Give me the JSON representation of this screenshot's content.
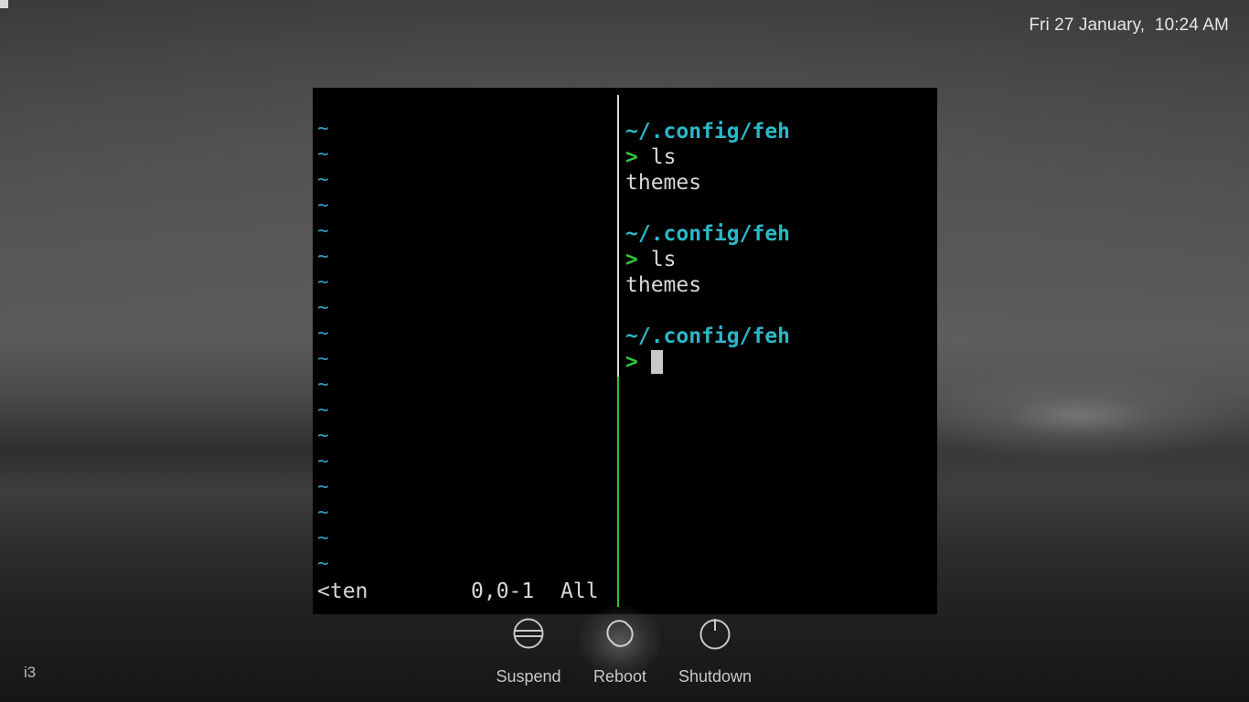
{
  "clock": {
    "text": "Fri 27 January,  10:24 AM"
  },
  "wm_label": "i3",
  "terminal": {
    "vim": {
      "tilde_char": "~",
      "tilde_count": 18,
      "status_left": "<ten",
      "status_position": "0,0-1",
      "status_scroll": "All"
    },
    "shell": {
      "lines": [
        {
          "kind": "path",
          "text": "~/.config/feh"
        },
        {
          "kind": "cmd",
          "prompt": ">",
          "text": "ls"
        },
        {
          "kind": "output",
          "text": "themes"
        },
        {
          "kind": "blank",
          "text": ""
        },
        {
          "kind": "path",
          "text": "~/.config/feh"
        },
        {
          "kind": "cmd",
          "prompt": ">",
          "text": "ls"
        },
        {
          "kind": "output",
          "text": "themes"
        },
        {
          "kind": "blank",
          "text": ""
        },
        {
          "kind": "path",
          "text": "~/.config/feh"
        },
        {
          "kind": "input",
          "prompt": ">",
          "text": ""
        }
      ]
    }
  },
  "power_menu": {
    "buttons": [
      {
        "id": "suspend",
        "label": "Suspend",
        "icon": "suspend-icon"
      },
      {
        "id": "reboot",
        "label": "Reboot",
        "icon": "reboot-icon",
        "highlighted": true
      },
      {
        "id": "shutdown",
        "label": "Shutdown",
        "icon": "power-icon"
      }
    ]
  },
  "colors": {
    "path": "#2ab8c8",
    "prompt": "#2fc83a",
    "tilde": "#2aa0c8",
    "active_border": "#2fbf3a"
  }
}
